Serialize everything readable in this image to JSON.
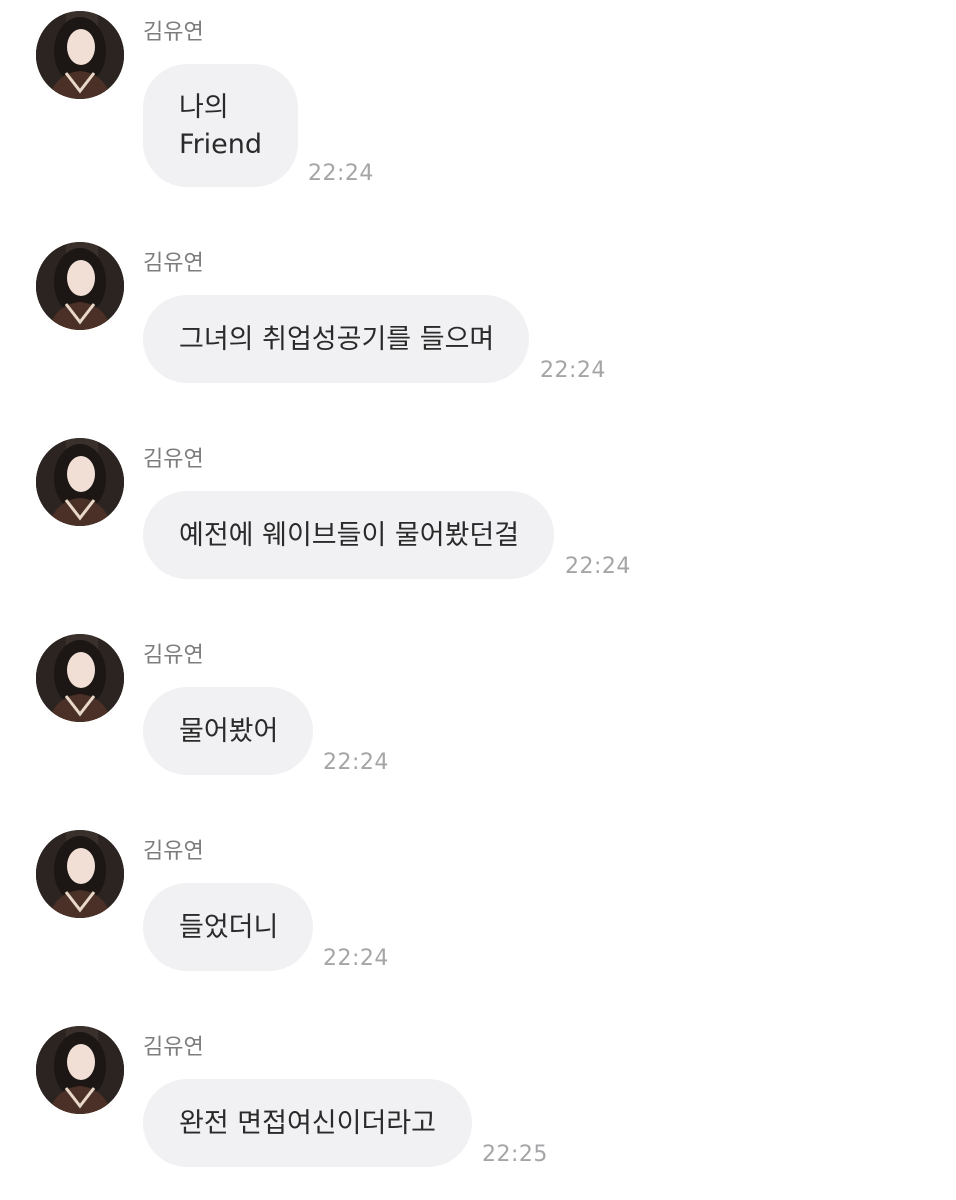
{
  "messages": [
    {
      "sender": "김유연",
      "lines": [
        "나의",
        "Friend"
      ],
      "time": "22:24"
    },
    {
      "sender": "김유연",
      "lines": [
        "그녀의 취업성공기를 들으며"
      ],
      "time": "22:24"
    },
    {
      "sender": "김유연",
      "lines": [
        "예전에 웨이브들이 물어봤던걸"
      ],
      "time": "22:24"
    },
    {
      "sender": "김유연",
      "lines": [
        "물어봤어"
      ],
      "time": "22:24"
    },
    {
      "sender": "김유연",
      "lines": [
        "들었더니"
      ],
      "time": "22:24"
    },
    {
      "sender": "김유연",
      "lines": [
        "완전 면접여신이더라고"
      ],
      "time": "22:25"
    }
  ],
  "colors": {
    "bubble": "#f1f1f3",
    "sender": "#7d7d7d",
    "time": "#a5a5a8",
    "text": "#2a2a2a"
  },
  "icons": {
    "avatar": "profile-photo"
  }
}
